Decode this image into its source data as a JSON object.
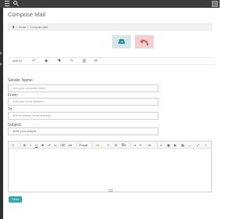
{
  "header": {
    "title": "Compose Mail",
    "breadcrumb": [
      "Email",
      "Compose Mail"
    ]
  },
  "actions": {
    "inbox_icon": "inbox-tray-icon",
    "back_icon": "reply-arrow-icon"
  },
  "toolbar": {
    "label": "Add Cc"
  },
  "form": {
    "sender_label": "Sender Name:",
    "sender_placeholder": "Add your company name",
    "from_label": "From:",
    "from_placeholder": "Add your email address",
    "to_label": "To:",
    "to_placeholder": "Add recipients email address",
    "subject_label": "Subject:",
    "subject_value": "Write your subject"
  },
  "editor": {
    "paragraph_select": "Para"
  },
  "send_label": "Send",
  "colors": {
    "topbar": "#3d3d3d",
    "accent": "#36a9b0",
    "inbox_button": "#d7e6e9",
    "back_button": "#f0d0d0",
    "back_icon": "#e05757"
  }
}
